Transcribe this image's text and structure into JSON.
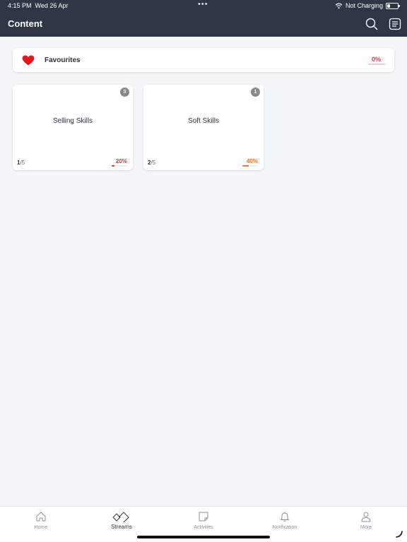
{
  "status_bar": {
    "time": "4:15 PM",
    "date": "Wed 26 Apr",
    "dots": "•••",
    "charging": "Not Charging"
  },
  "header": {
    "title": "Content",
    "icons": [
      "search-icon",
      "list-menu-icon"
    ]
  },
  "favourites": {
    "label": "Favourites",
    "percent": "0%",
    "progress_fraction": 0.0,
    "icon": "heart-icon",
    "accent_color": "#e8141c"
  },
  "streams": [
    {
      "name": "Selling Skills",
      "badge": "3",
      "completed": "1",
      "total": "/5",
      "percent": "20%",
      "progress_fraction": 0.2,
      "color": "#d9383a"
    },
    {
      "name": "Soft Skills",
      "badge": "1",
      "completed": "2",
      "total": "/5",
      "percent": "40%",
      "progress_fraction": 0.4,
      "color": "#e8762c"
    }
  ],
  "tabbar": {
    "items": [
      {
        "label": "Home",
        "icon": "home-icon"
      },
      {
        "label": "Streams",
        "icon": "streams-icon",
        "active": true
      },
      {
        "label": "Activities",
        "icon": "activities-icon"
      },
      {
        "label": "Notification",
        "icon": "bell-icon"
      },
      {
        "label": "More",
        "icon": "person-icon"
      }
    ]
  }
}
